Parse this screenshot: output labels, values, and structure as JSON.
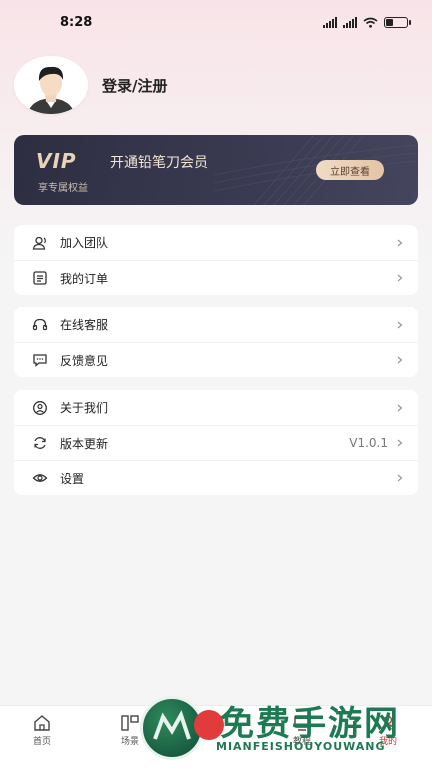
{
  "status_bar": {
    "time": "8:28"
  },
  "profile": {
    "login_label": "登录/注册"
  },
  "vip": {
    "logo": "VIP",
    "title": "开通铅笔刀会员",
    "subtitle": "享专属权益",
    "button": "立即查看"
  },
  "menu_groups": [
    {
      "items": [
        {
          "icon": "team-icon",
          "label": "加入团队"
        },
        {
          "icon": "order-icon",
          "label": "我的订单"
        }
      ]
    },
    {
      "items": [
        {
          "icon": "headset-icon",
          "label": "在线客服"
        },
        {
          "icon": "feedback-icon",
          "label": "反馈意见"
        }
      ]
    },
    {
      "items": [
        {
          "icon": "about-icon",
          "label": "关于我们"
        },
        {
          "icon": "refresh-icon",
          "label": "版本更新",
          "value": "V1.0.1"
        },
        {
          "icon": "eye-icon",
          "label": "设置"
        }
      ]
    }
  ],
  "tab_bar": {
    "tabs": [
      {
        "label": "首页",
        "icon": "home-icon"
      },
      {
        "label": "场景",
        "icon": "scene-icon"
      },
      {
        "label": "教程",
        "icon": "tutorial-icon"
      },
      {
        "label": "我的",
        "icon": "profile-icon",
        "active": true
      }
    ]
  },
  "watermark": {
    "title": "免费手游网",
    "subtitle": "MIANFEISHOUYOUWANG"
  },
  "colors": {
    "vip_bg": "#2e2e42",
    "vip_gold": "#e8d2b8",
    "active_tab": "#cc3333",
    "watermark_green": "#1d7a52"
  }
}
